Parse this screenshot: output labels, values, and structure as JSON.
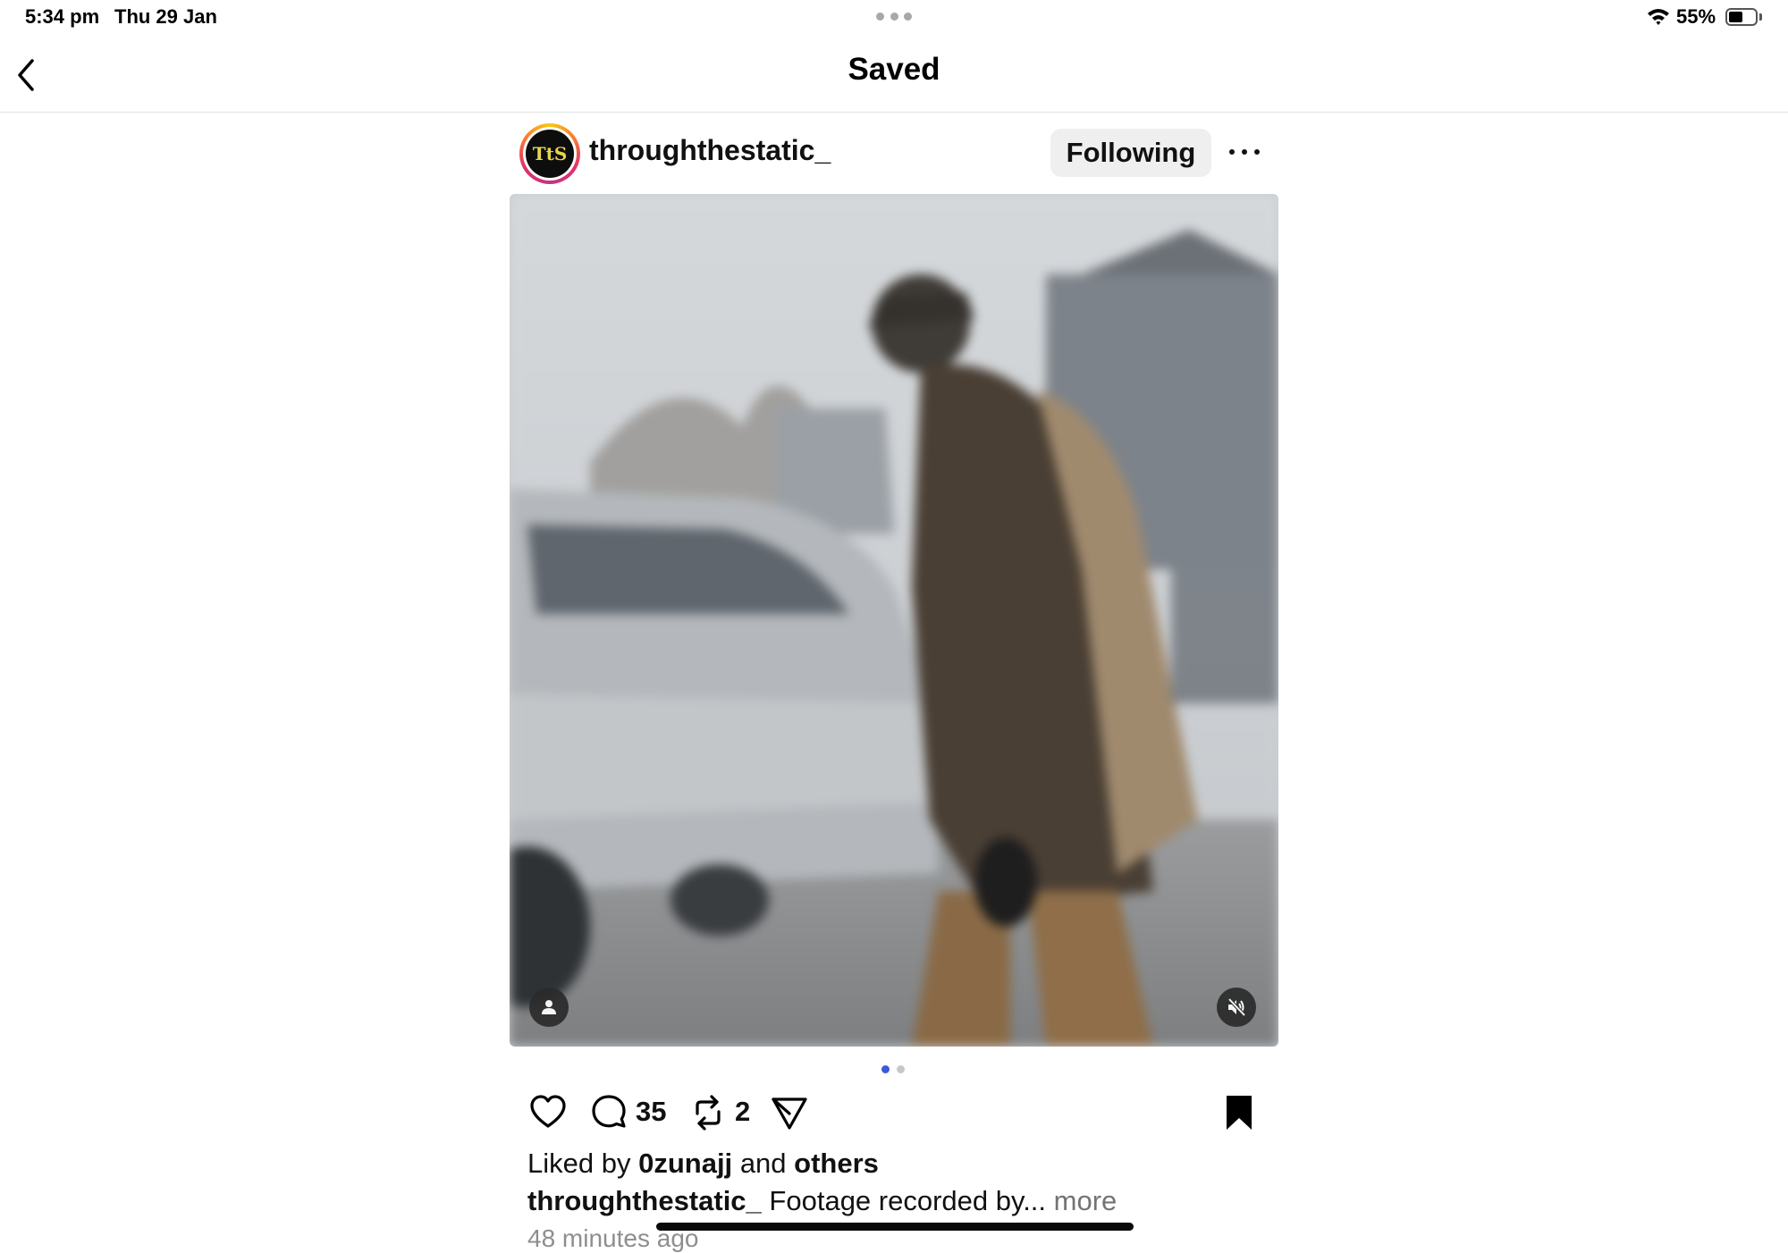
{
  "status_bar": {
    "time": "5:34 pm",
    "date": "Thu 29 Jan",
    "battery_percent": "55%",
    "battery_level": 0.55
  },
  "header": {
    "title": "Saved",
    "back_icon": "chevron-left-icon"
  },
  "post": {
    "username": "throughthestatic_",
    "avatar_text": "TtS",
    "follow_label": "Following",
    "carousel": {
      "total": 2,
      "active": 0
    },
    "actions": {
      "comments_count": "35",
      "reposts_count": "2"
    },
    "liked_by": {
      "prefix": "Liked by",
      "user": "0zunajj",
      "middle": "and",
      "suffix": "others"
    },
    "caption": {
      "username": "throughthestatic_",
      "text": "Footage recorded by...",
      "more_label": "more"
    },
    "time_ago": "48 minutes ago"
  },
  "colors": {
    "carousel_active": "#3b5bdb",
    "carousel_inactive": "#c7c7c7",
    "follow_bg": "#efefef"
  }
}
